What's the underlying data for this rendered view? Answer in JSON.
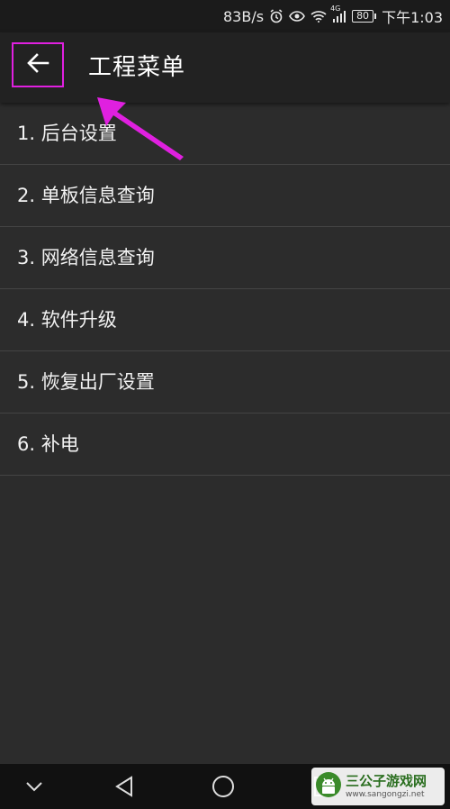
{
  "status_bar": {
    "speed": "83B/s",
    "network_type": "4G",
    "battery": "80",
    "time": "下午1:03",
    "icons": [
      "alarm-icon",
      "eye-icon",
      "wifi-icon",
      "signal-icon",
      "battery-icon"
    ]
  },
  "app_bar": {
    "title": "工程菜单",
    "back_icon": "arrow-left-icon"
  },
  "menu": {
    "items": [
      {
        "label": "1. 后台设置"
      },
      {
        "label": "2. 单板信息查询"
      },
      {
        "label": "3. 网络信息查询"
      },
      {
        "label": "4. 软件升级"
      },
      {
        "label": "5. 恢复出厂设置"
      },
      {
        "label": "6. 补电"
      }
    ]
  },
  "nav_bar": {
    "icons": [
      "chevron-down-icon",
      "triangle-back-icon",
      "circle-home-icon",
      "square-recents-icon"
    ]
  },
  "watermark": {
    "title": "三公子游戏网",
    "url": "www.sangongzi.net"
  },
  "colors": {
    "background": "#2c2c2c",
    "app_bar": "#222222",
    "status_bar": "#1b1b1b",
    "highlight": "#e020e0"
  }
}
